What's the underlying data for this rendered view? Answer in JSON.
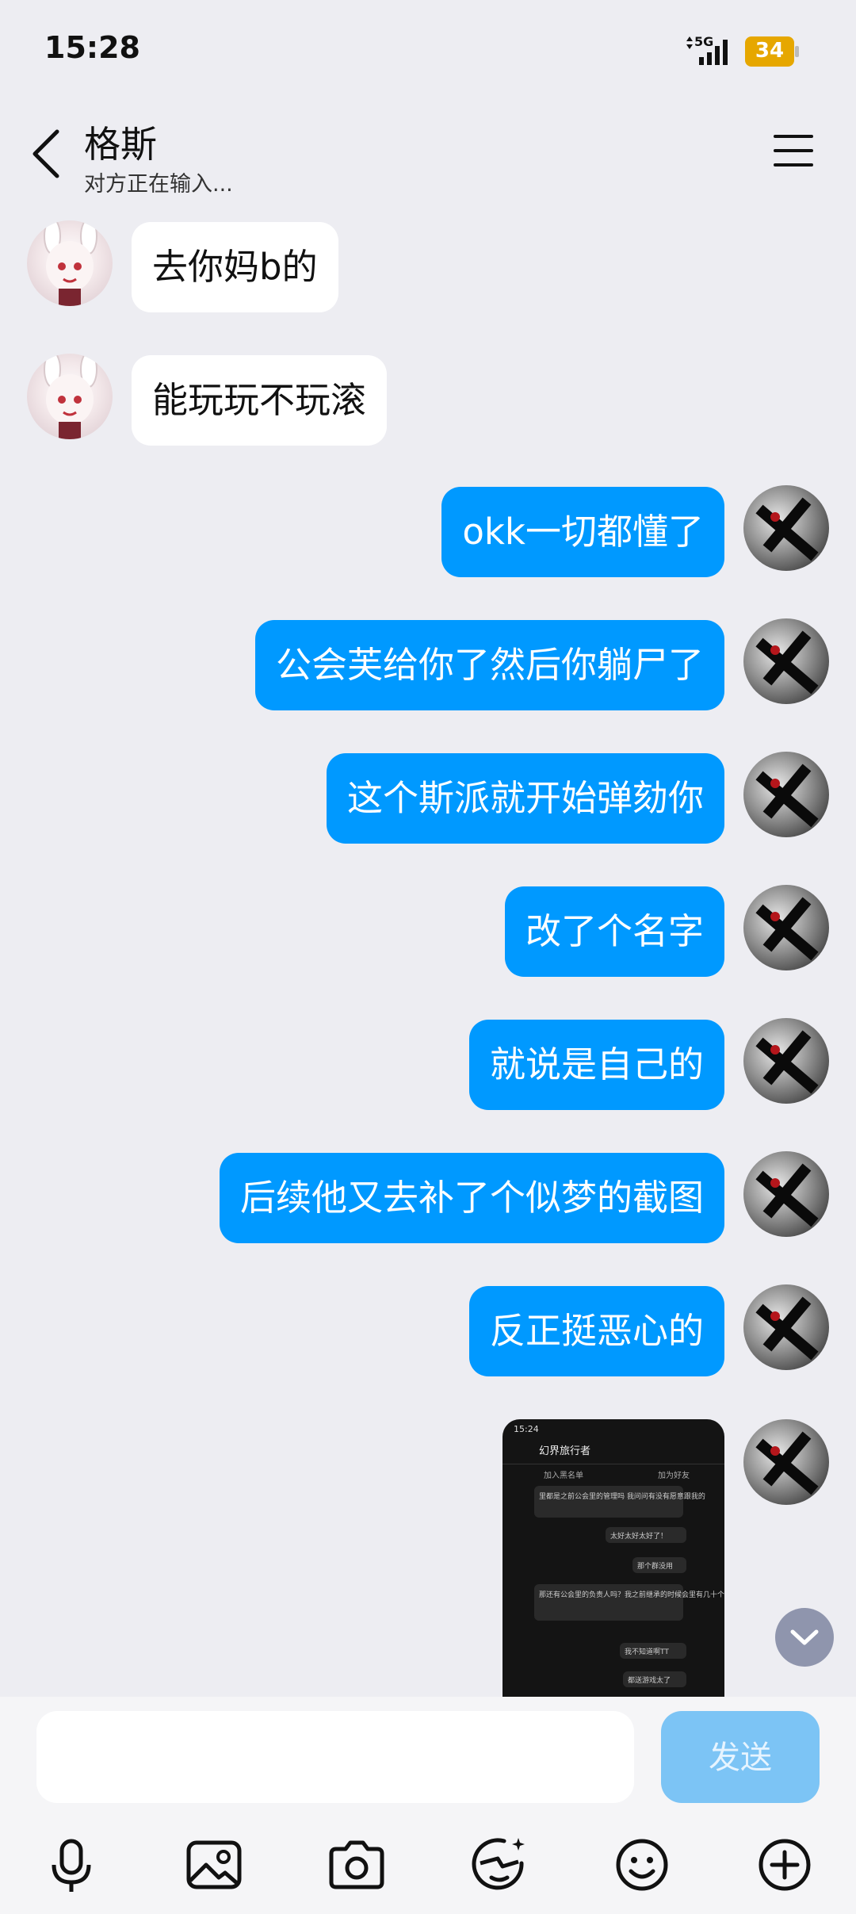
{
  "status_bar": {
    "time": "15:28",
    "network": "5G",
    "battery": "34",
    "battery_color": "#e6a700"
  },
  "header": {
    "contact_name": "格斯",
    "typing_status": "对方正在输入...",
    "back_icon": "chevron-left-icon",
    "menu_icon": "hamburger-menu-icon"
  },
  "messages": [
    {
      "side": "left",
      "text": "去你妈b的"
    },
    {
      "side": "left",
      "text": "能玩玩不玩滚"
    },
    {
      "side": "right",
      "text": "okk一切都懂了"
    },
    {
      "side": "right",
      "text": "公会芙给你了然后你躺尸了"
    },
    {
      "side": "right",
      "text": "这个斯派就开始弹劾你"
    },
    {
      "side": "right",
      "text": "改了个名字"
    },
    {
      "side": "right",
      "text": "就说是自己的"
    },
    {
      "side": "right",
      "text": "后续他又去补了个似梦的截图"
    },
    {
      "side": "right",
      "text": "反正挺恶心的"
    }
  ],
  "image_message": {
    "time": "15:24",
    "title": "幻界旅行者",
    "add_blacklist": "加入黑名单",
    "add_friend": "加为好友",
    "lines": [
      {
        "side": "left",
        "text": "里都是之前公会里的管理吗 我问问有没有愿意跟我的"
      },
      {
        "side": "right",
        "text": "太好太好太好了！"
      },
      {
        "side": "right",
        "text": "那个群没用"
      },
      {
        "side": "left",
        "text": "那还有公会里的负责人吗？我之前继承的时候会里有几十个聊天号，不知道是谁控的"
      },
      {
        "side": "right",
        "text": "我不知道啊TT"
      },
      {
        "side": "right",
        "text": "都送游戏太了"
      }
    ]
  },
  "input_bar": {
    "placeholder": "",
    "send_label": "发送",
    "accent": "#0099ff"
  },
  "toolbar": [
    {
      "icon": "microphone-icon"
    },
    {
      "icon": "image-icon"
    },
    {
      "icon": "camera-icon"
    },
    {
      "icon": "sticker-face-icon"
    },
    {
      "icon": "emoji-icon"
    },
    {
      "icon": "plus-icon"
    }
  ]
}
